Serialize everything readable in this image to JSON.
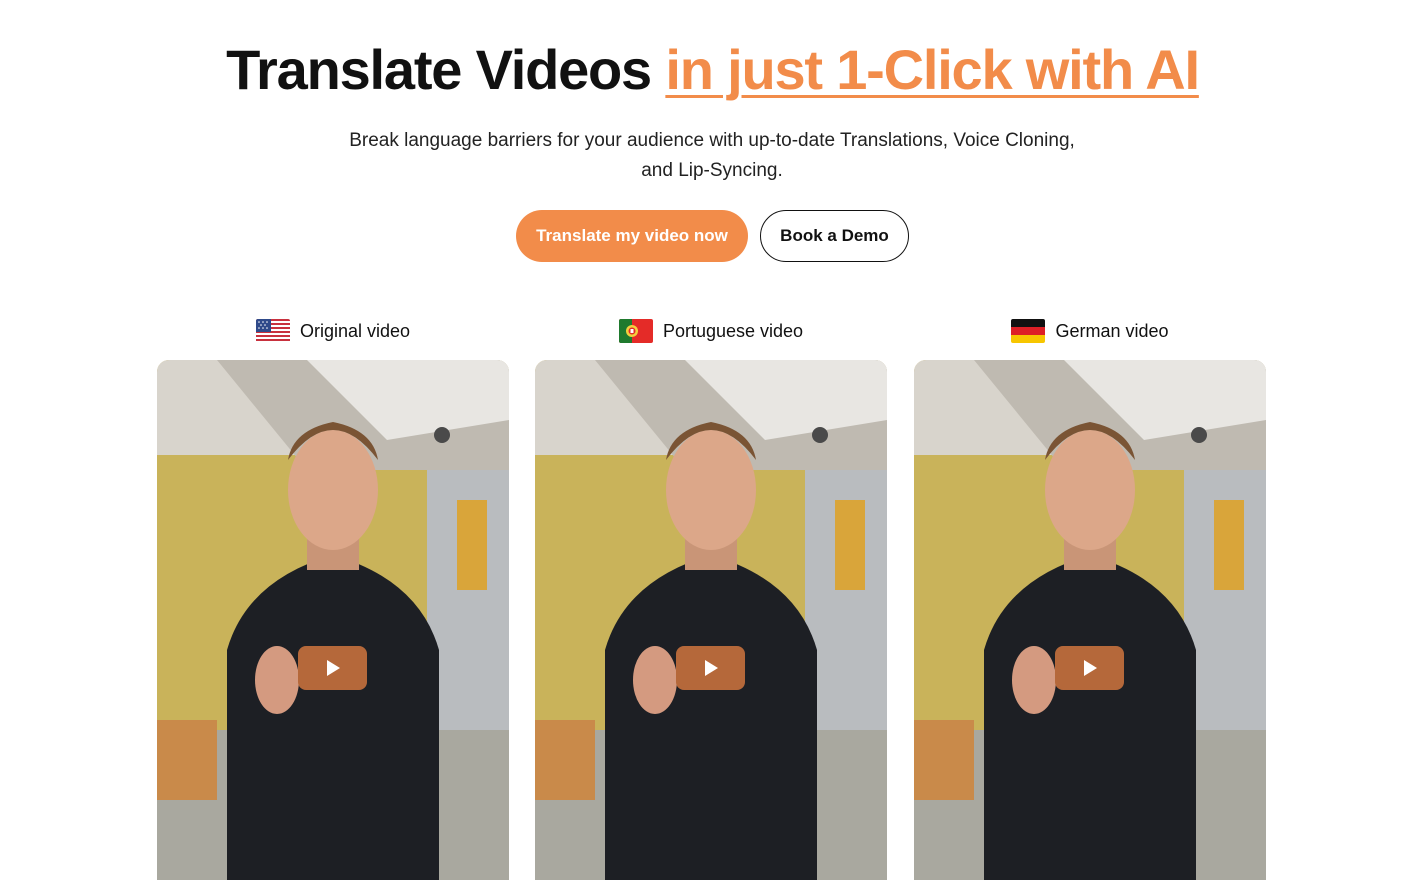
{
  "hero": {
    "title_main": "Translate Videos ",
    "title_accent": "in just 1-Click with AI",
    "subtitle_line1": "Break language barriers for your audience with up-to-date Translations, Voice Cloning,",
    "subtitle_line2": "and Lip-Syncing.",
    "accent_color": "#f28c4a"
  },
  "cta": {
    "primary_label": "Translate my video now",
    "secondary_label": "Book a Demo"
  },
  "videos": [
    {
      "label": "Original video",
      "flag": "us-flag-icon"
    },
    {
      "label": "Portuguese video",
      "flag": "portugal-flag-icon"
    },
    {
      "label": "German video",
      "flag": "germany-flag-icon"
    }
  ]
}
